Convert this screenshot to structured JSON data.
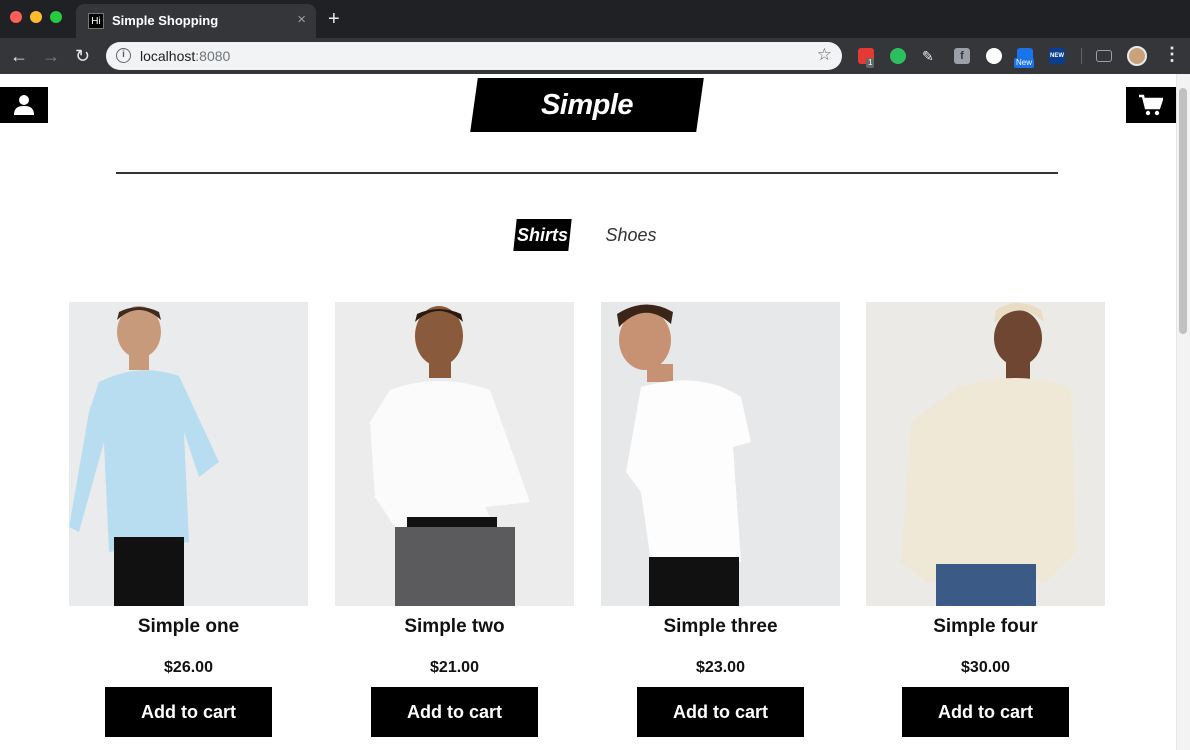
{
  "browser": {
    "tab_favicon_text": "Hi",
    "tab_title": "Simple Shopping",
    "tab_close": "×",
    "new_tab": "+",
    "url_host": "localhost",
    "url_port": ":8080",
    "extensions": [
      "email-icon",
      "evernote-icon",
      "pen-icon",
      "f-icon",
      "circle-icon",
      "new-extension-icon",
      "new-extension-icon-2"
    ],
    "ext_badge_count": "1",
    "ext_badge_new": "New",
    "ext_new_label": "NEW"
  },
  "header": {
    "logo": "Simple Shopping"
  },
  "categories": {
    "active": "Shirts",
    "inactive": "Shoes"
  },
  "products": [
    {
      "name": "Simple one",
      "price": "$26.00",
      "button": "Add to cart",
      "shirt_color": "#b9ddf0"
    },
    {
      "name": "Simple two",
      "price": "$21.00",
      "button": "Add to cart",
      "shirt_color": "#ffffff"
    },
    {
      "name": "Simple three",
      "price": "$23.00",
      "button": "Add to cart",
      "shirt_color": "#ffffff"
    },
    {
      "name": "Simple four",
      "price": "$30.00",
      "button": "Add to cart",
      "shirt_color": "#efe8d7"
    }
  ],
  "colors": {
    "chrome_dark": "#202124",
    "chrome_toolbar": "#35363a",
    "accent": "#000000"
  }
}
